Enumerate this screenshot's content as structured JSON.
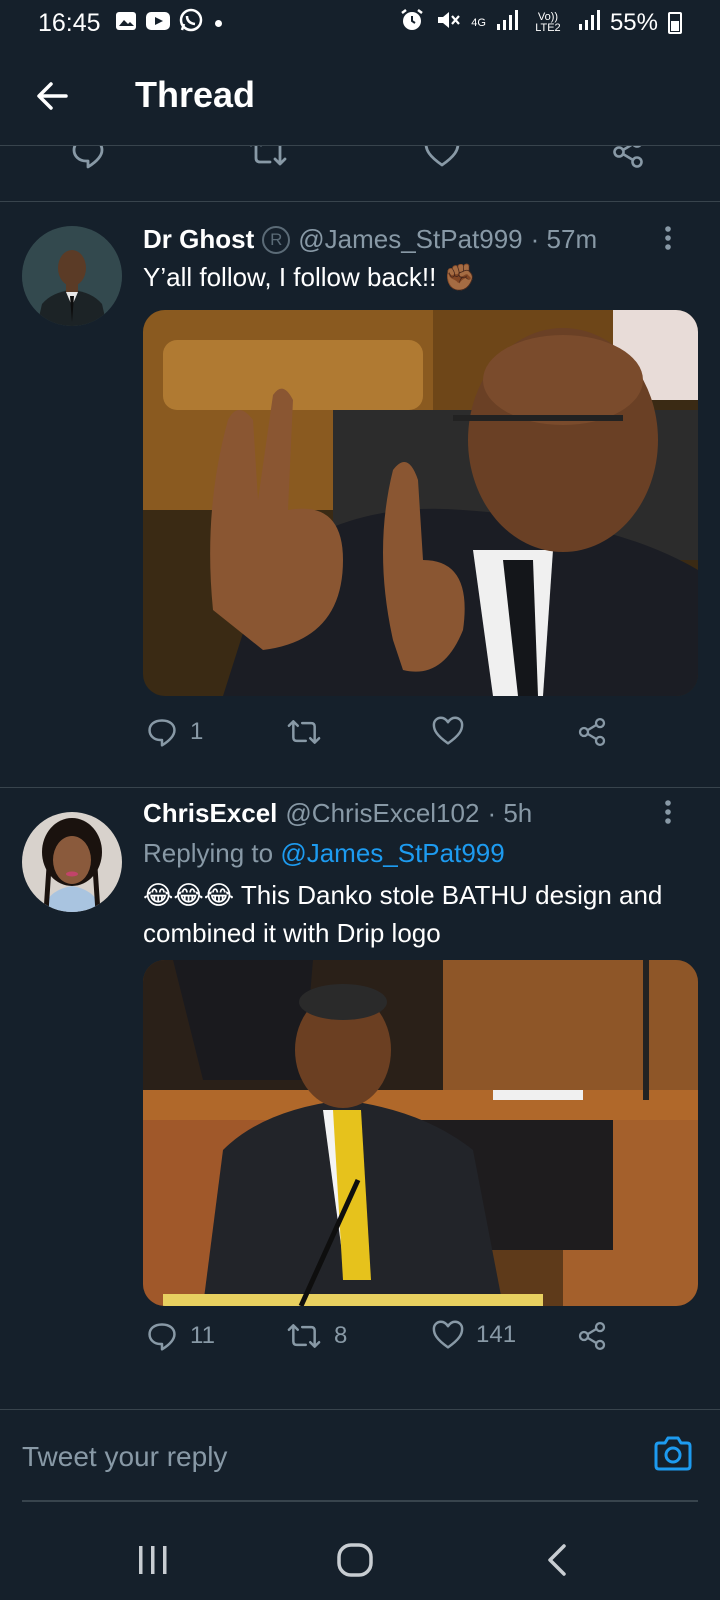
{
  "status_bar": {
    "time": "16:45",
    "network_4g": "4G",
    "volte_label": "Vo)) LTE2",
    "battery": "55%",
    "icons": [
      "gallery-icon",
      "youtube-icon",
      "whatsapp-icon",
      "alarm-icon",
      "mute-icon",
      "signal-icon",
      "battery-icon"
    ]
  },
  "header": {
    "title": "Thread"
  },
  "tweets": [
    {
      "name": "Dr Ghost",
      "badge": "R",
      "handle": "@James_StPat999",
      "time": "· 57m",
      "text": "Y’all follow, I follow back!! ✊🏾",
      "replies": "1",
      "retweets": "",
      "likes": ""
    },
    {
      "name": "ChrisExcel",
      "handle": "@ChrisExcel102",
      "time": "· 5h",
      "replying_prefix": "Replying to",
      "replying_to": "@James_StPat999",
      "text": "😂😂😂 This Danko stole BATHU design and combined it with Drip logo",
      "replies": "11",
      "retweets": "8",
      "likes": "141"
    }
  ],
  "reply_bar": {
    "placeholder": "Tweet your reply"
  },
  "colors": {
    "background": "#15202b",
    "divider": "#38444d",
    "muted": "#8899a6",
    "accent": "#1d9bf0"
  }
}
